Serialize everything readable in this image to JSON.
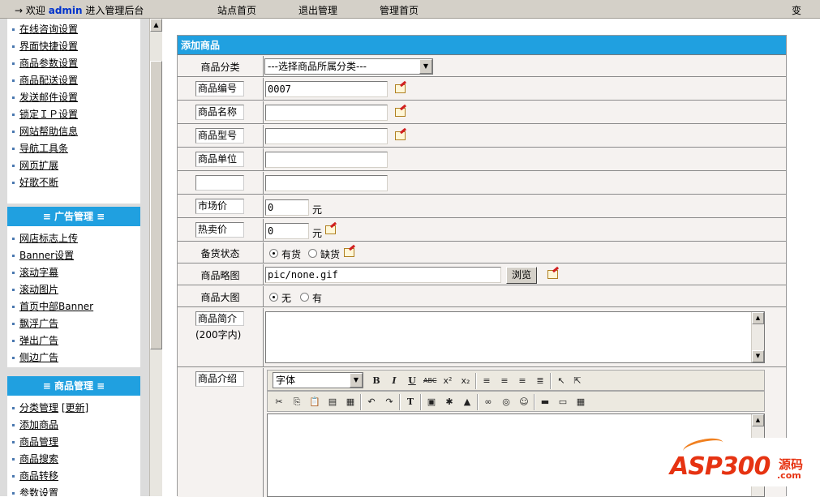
{
  "topbar": {
    "welcome_prefix": "欢迎",
    "user": "admin",
    "welcome_suffix": "进入管理后台",
    "links": [
      "站点首页",
      "退出管理",
      "管理首页"
    ],
    "right_text": "变"
  },
  "sidebar": {
    "group1": {
      "items": [
        "在线咨询设置",
        "界面快捷设置",
        "商品参数设置",
        "商品配送设置",
        "发送邮件设置",
        "锁定ＩＰ设置",
        "网站帮助信息",
        "导航工具条",
        "网页扩展",
        "好歌不断"
      ]
    },
    "group2": {
      "title": "≡ 广告管理 ≡",
      "items": [
        "网店标志上传",
        "Banner设置",
        "滚动字幕",
        "滚动图片",
        "首页中部Banner",
        "飘浮广告",
        "弹出广告",
        "侧边广告"
      ]
    },
    "group3": {
      "title": "≡ 商品管理 ≡",
      "items": [
        "分类管理",
        "添加商品",
        "商品管理",
        "商品搜索",
        "商品转移",
        "参数设置"
      ],
      "update_link": "[更新]"
    }
  },
  "form": {
    "title": "添加商品",
    "category_label": "商品分类",
    "category_value": "---选择商品所属分类---",
    "code_label": "商品编号",
    "code_value": "0007",
    "name_label": "商品名称",
    "model_label": "商品型号",
    "unit_label": "商品单位",
    "market_price_label": "市场价",
    "market_price_value": "0",
    "hot_price_label": "热卖价",
    "hot_price_value": "0",
    "currency": "元",
    "stock_label": "备货状态",
    "stock_options": [
      "有货",
      "缺货"
    ],
    "thumb_label": "商品略图",
    "thumb_value": "pic/none.gif",
    "browse_label": "浏览",
    "large_label": "商品大图",
    "large_options": [
      "无",
      "有"
    ],
    "brief_label": "商品简介",
    "brief_sub": "(200字内)",
    "intro_label": "商品介绍",
    "font_select": "字体"
  },
  "watermark": {
    "logo": "ASP300",
    "cn": "源码",
    "com": ".com"
  }
}
